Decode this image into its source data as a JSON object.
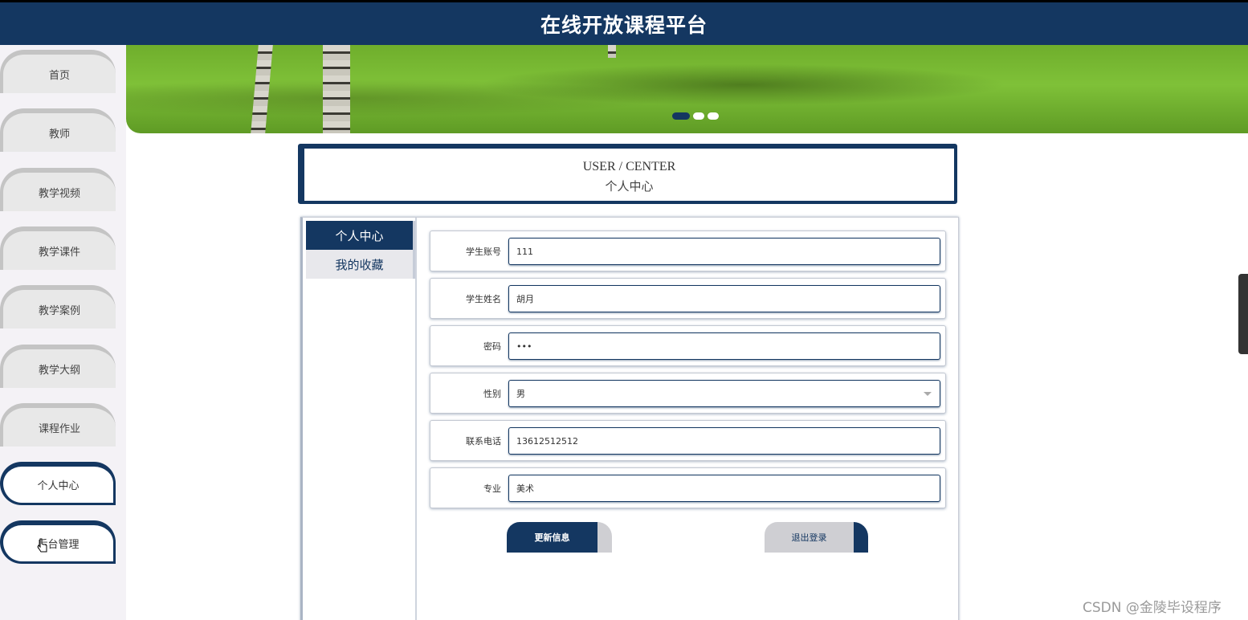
{
  "header": {
    "title": "在线开放课程平台"
  },
  "sidebar": {
    "items": [
      {
        "label": "首页"
      },
      {
        "label": "教师"
      },
      {
        "label": "教学视频"
      },
      {
        "label": "教学课件"
      },
      {
        "label": "教学案例"
      },
      {
        "label": "教学大纲"
      },
      {
        "label": "课程作业"
      },
      {
        "label": "个人中心"
      },
      {
        "label": "后台管理"
      }
    ]
  },
  "banner": {
    "active_slide": 1,
    "slide_count": 3
  },
  "center": {
    "title_en": "USER / CENTER",
    "title_cn": "个人中心"
  },
  "tabs": [
    {
      "label": "个人中心",
      "active": true
    },
    {
      "label": "我的收藏",
      "active": false
    }
  ],
  "form": {
    "fields": [
      {
        "label": "学生账号",
        "value": "111"
      },
      {
        "label": "学生姓名",
        "value": "胡月"
      },
      {
        "label": "密码",
        "value": "•••"
      },
      {
        "label": "性别",
        "value": "男"
      },
      {
        "label": "联系电话",
        "value": "13612512512"
      },
      {
        "label": "专业",
        "value": "美术"
      }
    ],
    "update_label": "更新信息",
    "logout_label": "退出登录"
  },
  "watermark": "CSDN @金陵毕设程序",
  "colors": {
    "primary": "#143761",
    "secondary": "#cfcfd3"
  }
}
